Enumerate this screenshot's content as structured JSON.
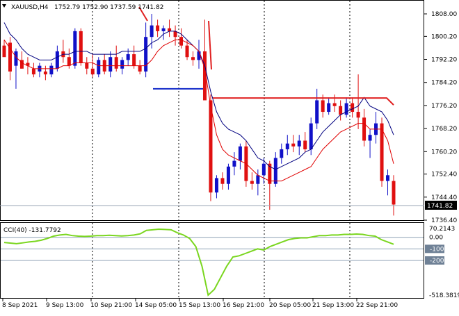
{
  "header": {
    "symbol": "XAUUSD,H4",
    "ohlc": "1752.79 1752.90 1737.59 1741.82"
  },
  "colors": {
    "background": "#ffffff",
    "bull": "#1010c8",
    "bear": "#e01010",
    "ma_fast": "#000080",
    "ma_slow": "#e00000",
    "cci": "#7ad61f",
    "resistance": "#e02020",
    "support": "#1028c8"
  },
  "price_axis": {
    "ticks": [
      "1808.00",
      "1800.20",
      "1792.20",
      "1784.20",
      "1776.20",
      "1768.20",
      "1760.20",
      "1752.40",
      "1744.40",
      "1736.40"
    ],
    "current_price_label": "1741.82"
  },
  "cci": {
    "label": "CCI(40) -131.7792",
    "ticks": [
      "70.2143",
      "0.00",
      "-100",
      "-200",
      "-518.3819"
    ]
  },
  "time_axis": {
    "ticks": [
      "8 Sep 2021",
      "9 Sep 13:00",
      "10 Sep 21:00",
      "14 Sep 05:00",
      "15 Sep 13:00",
      "16 Sep 21:00",
      "20 Sep 05:00",
      "21 Sep 13:00",
      "22 Sep 21:00"
    ]
  },
  "chart_data": {
    "type": "candlestick",
    "title": "XAUUSD,H4",
    "ylim": [
      1736.4,
      1812
    ],
    "candles": [
      [
        1797,
        1799,
        1795,
        1793
      ],
      [
        1798,
        1800,
        1785,
        1788
      ],
      [
        1790,
        1796,
        1782,
        1795
      ],
      [
        1792,
        1795,
        1789,
        1789
      ],
      [
        1791,
        1793,
        1787,
        1790
      ],
      [
        1789,
        1791,
        1786,
        1787
      ],
      [
        1788,
        1791,
        1786,
        1790
      ],
      [
        1788,
        1790,
        1785,
        1787
      ],
      [
        1787,
        1791,
        1786,
        1790
      ],
      [
        1789,
        1797,
        1788,
        1795
      ],
      [
        1795,
        1799,
        1791,
        1793
      ],
      [
        1793,
        1796,
        1789,
        1790
      ],
      [
        1790,
        1803,
        1789,
        1802
      ],
      [
        1802,
        1803,
        1790,
        1791
      ],
      [
        1791,
        1793,
        1787,
        1789
      ],
      [
        1789,
        1794,
        1786,
        1787
      ],
      [
        1787,
        1793,
        1786,
        1792
      ],
      [
        1792,
        1794,
        1787,
        1788
      ],
      [
        1788,
        1795,
        1786,
        1793
      ],
      [
        1793,
        1797,
        1788,
        1789
      ],
      [
        1789,
        1793,
        1787,
        1792
      ],
      [
        1792,
        1796,
        1790,
        1794
      ],
      [
        1794,
        1797,
        1789,
        1790
      ],
      [
        1790,
        1792,
        1787,
        1788
      ],
      [
        1788,
        1805,
        1786,
        1800
      ],
      [
        1800,
        1808,
        1796,
        1804
      ],
      [
        1804,
        1806,
        1800,
        1802
      ],
      [
        1802,
        1804,
        1799,
        1803
      ],
      [
        1803,
        1806,
        1800,
        1802
      ],
      [
        1802,
        1804,
        1797,
        1800
      ],
      [
        1800,
        1803,
        1796,
        1797
      ],
      [
        1797,
        1799,
        1792,
        1793
      ],
      [
        1793,
        1795,
        1790,
        1792
      ],
      [
        1792,
        1799,
        1789,
        1795
      ],
      [
        1795,
        1806,
        1779,
        1778
      ],
      [
        1778,
        1780,
        1743,
        1746
      ],
      [
        1746,
        1752,
        1744,
        1751
      ],
      [
        1751,
        1753,
        1747,
        1749
      ],
      [
        1749,
        1756,
        1747,
        1755
      ],
      [
        1755,
        1760,
        1752,
        1757
      ],
      [
        1757,
        1763,
        1754,
        1762
      ],
      [
        1762,
        1764,
        1748,
        1750
      ],
      [
        1750,
        1753,
        1747,
        1749
      ],
      [
        1749,
        1754,
        1745,
        1752
      ],
      [
        1752,
        1758,
        1749,
        1756
      ],
      [
        1756,
        1757,
        1740,
        1749
      ],
      [
        1749,
        1760,
        1748,
        1758
      ],
      [
        1758,
        1763,
        1756,
        1761
      ],
      [
        1761,
        1766,
        1759,
        1763
      ],
      [
        1763,
        1766,
        1760,
        1762
      ],
      [
        1762,
        1766,
        1759,
        1764
      ],
      [
        1764,
        1767,
        1760,
        1761
      ],
      [
        1761,
        1772,
        1759,
        1770
      ],
      [
        1770,
        1782,
        1768,
        1778
      ],
      [
        1778,
        1780,
        1772,
        1774
      ],
      [
        1774,
        1779,
        1773,
        1777
      ],
      [
        1777,
        1780,
        1774,
        1776
      ],
      [
        1776,
        1778,
        1771,
        1773
      ],
      [
        1773,
        1779,
        1772,
        1777
      ],
      [
        1777,
        1779,
        1772,
        1774
      ],
      [
        1774,
        1787,
        1768,
        1772
      ],
      [
        1772,
        1775,
        1762,
        1764
      ],
      [
        1764,
        1768,
        1758,
        1766
      ],
      [
        1766,
        1774,
        1763,
        1770
      ],
      [
        1770,
        1772,
        1748,
        1750
      ],
      [
        1750,
        1754,
        1745,
        1752
      ],
      [
        1750,
        1752,
        1738,
        1741.82
      ]
    ],
    "ma_fast": [
      1805,
      1801,
      1799,
      1796,
      1794,
      1793,
      1792,
      1792,
      1792,
      1793,
      1794,
      1794,
      1795,
      1795,
      1795,
      1794,
      1794,
      1794,
      1794,
      1794,
      1795,
      1795,
      1795,
      1795,
      1796,
      1798,
      1799,
      1801,
      1802,
      1802,
      1801,
      1799,
      1797,
      1795,
      1790,
      1781,
      1774,
      1770,
      1768,
      1767,
      1766,
      1764,
      1761,
      1758,
      1757,
      1755,
      1754,
      1755,
      1756,
      1757,
      1758,
      1760,
      1761,
      1764,
      1767,
      1769,
      1771,
      1773,
      1774,
      1775,
      1776,
      1779,
      1776,
      1775,
      1774,
      1771,
      1766
    ],
    "ma_slow": [
      1799,
      1796,
      1793,
      1791,
      1790,
      1789,
      1789,
      1789,
      1789,
      1789,
      1790,
      1790,
      1791,
      1791,
      1791,
      1791,
      1790,
      1790,
      1790,
      1790,
      1790,
      1790,
      1790,
      1790,
      1790,
      1792,
      1795,
      1797,
      1798,
      1799,
      1799,
      1798,
      1797,
      1795,
      1789,
      1776,
      1766,
      1761,
      1759,
      1758,
      1757,
      1756,
      1754,
      1752,
      1751,
      1750,
      1750,
      1750,
      1751,
      1752,
      1753,
      1754,
      1755,
      1758,
      1761,
      1763,
      1765,
      1767,
      1768,
      1769,
      1770,
      1770,
      1768,
      1768,
      1768,
      1764,
      1756
    ],
    "cci_values": [
      -45,
      -50,
      -55,
      -48,
      -40,
      -35,
      -25,
      -10,
      10,
      20,
      25,
      15,
      10,
      8,
      10,
      15,
      15,
      18,
      15,
      12,
      15,
      20,
      30,
      60,
      65,
      70,
      68,
      65,
      40,
      20,
      -10,
      -80,
      -250,
      -500,
      -450,
      -350,
      -250,
      -170,
      -160,
      -140,
      -120,
      -100,
      -110,
      -80,
      -60,
      -40,
      -20,
      -10,
      -5,
      -5,
      5,
      15,
      15,
      20,
      20,
      25,
      25,
      28,
      25,
      15,
      10,
      -20,
      -40,
      -60
    ],
    "resistance_level": 1778.8,
    "support_level": 1782.0
  }
}
